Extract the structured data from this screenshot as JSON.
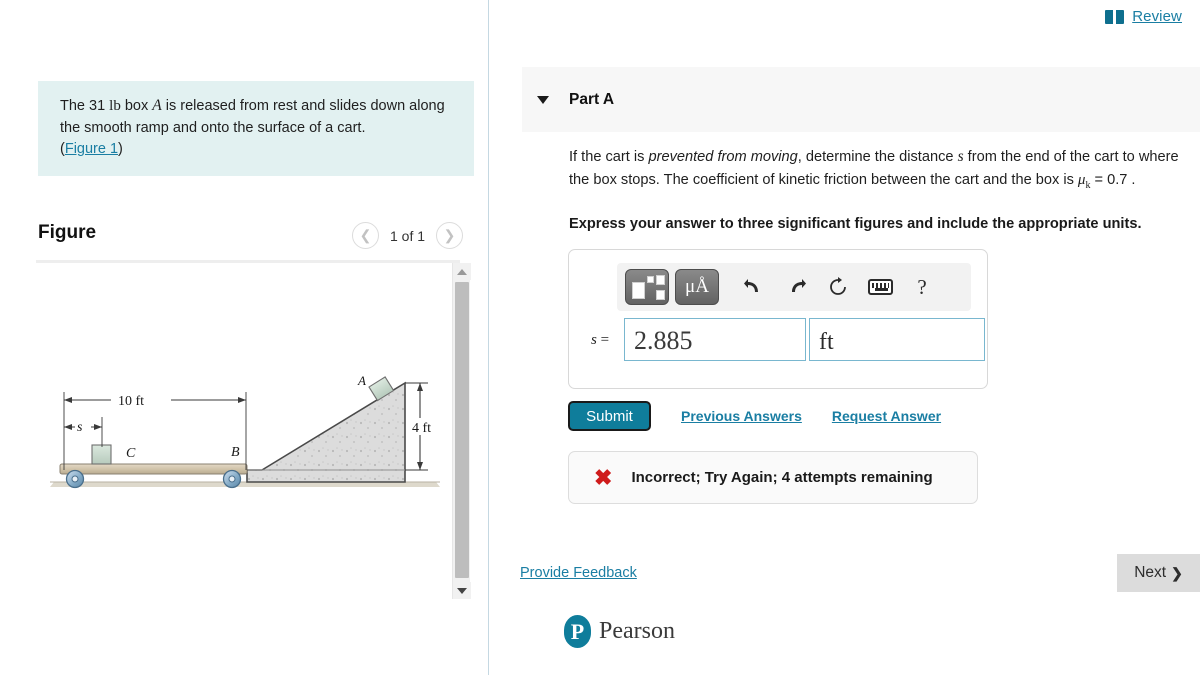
{
  "top": {
    "review_label": "Review",
    "book_icon": "book-icon"
  },
  "left": {
    "hint": {
      "text_part1": "The 31 ",
      "unit": "lb",
      "text_part2": " box ",
      "body_label": "A",
      "text_part3": " is released from rest and slides down along the smooth ramp and onto the surface of a cart.",
      "figure_link": "Figure 1"
    },
    "figure_title": "Figure",
    "nav": {
      "prev_icon": "chevron-left-icon",
      "count_label": "1 of 1",
      "next_icon": "chevron-right-icon"
    },
    "diagram": {
      "dim_top_label": "10 ft",
      "dim_s_label": "s",
      "dim_height_label": "4 ft",
      "point_a": "A",
      "point_b": "B",
      "point_c": "C"
    }
  },
  "right": {
    "part": {
      "caret_icon": "caret-down-icon",
      "label": "Part A"
    },
    "question": {
      "seg1": "If the cart is ",
      "emphasis": "prevented from moving",
      "seg2": ", determine the distance ",
      "var_s": "s",
      "seg3": " from the end of the cart to where the box stops. The coefficient of kinetic friction between the cart and the box is ",
      "mu_symbol": "μ",
      "mu_subscript": "k",
      "seg4": " = 0.7 ."
    },
    "express_note": "Express your answer to three significant figures and include the appropriate units.",
    "toolbar": {
      "template_icon": "math-template-icon",
      "units_icon": "μÅ",
      "undo_icon": "undo-arrow-icon",
      "redo_icon": "redo-arrow-icon",
      "reset_icon": "reset-circular-arrow-icon",
      "keyboard_icon": "keyboard-icon",
      "help_icon": "?"
    },
    "answer": {
      "equals_var": "s",
      "equals_sign": " =",
      "value": "2.885",
      "units": "ft",
      "value_placeholder": "",
      "units_placeholder": ""
    },
    "actions": {
      "submit_label": "Submit",
      "previous_answers_label": "Previous Answers",
      "request_answer_label": "Request Answer"
    },
    "feedback": {
      "status_icon": "✖",
      "message": "Incorrect; Try Again; 4 attempts remaining"
    },
    "footer": {
      "provide_feedback_label": "Provide Feedback",
      "next_label": "Next",
      "next_chevron": "❯",
      "brand_mark": "P",
      "brand_name": "Pearson"
    }
  },
  "colors": {
    "accent_teal": "#0f7d9b",
    "link_blue": "#1a7ea3",
    "hint_bg": "#e2f1f1",
    "error_red": "#cf1b1b",
    "panel_gray": "#f7f7f7"
  }
}
